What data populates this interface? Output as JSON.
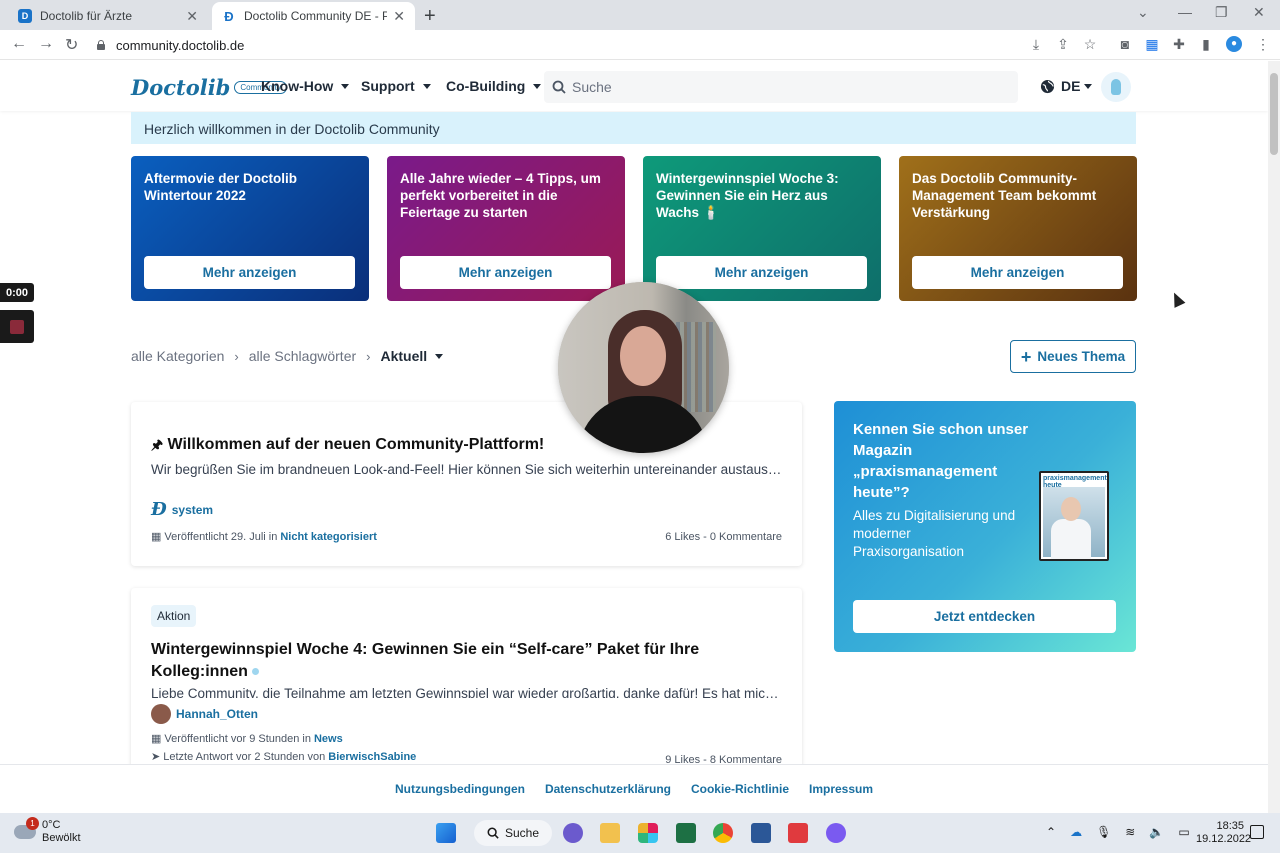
{
  "browser": {
    "tabs": [
      {
        "label": "Doctolib für Ärzte",
        "active": false
      },
      {
        "label": "Doctolib Community DE - Plattfo",
        "active": true
      }
    ],
    "url": "community.doctolib.de"
  },
  "header": {
    "logo_word": "Doctolib",
    "logo_pill": "Community",
    "nav": [
      {
        "label": "Know-How"
      },
      {
        "label": "Support"
      },
      {
        "label": "Co-Building"
      }
    ],
    "search_placeholder": "Suche",
    "language": "DE"
  },
  "welcome_banner": "Herzlich willkommen in der Doctolib Community",
  "featured_cards": [
    {
      "title": "Aftermovie der Doctolib Wintertour 2022",
      "button": "Mehr anzeigen",
      "color": "#0a4aa0"
    },
    {
      "title": "Alle Jahre wieder – 4 Tipps, um perfekt vorbereitet in die Feiertage zu starten",
      "button": "Mehr anzeigen",
      "color": "#8a1a70"
    },
    {
      "title": "Wintergewinnspiel Woche 3: Gewinnen Sie ein Herz aus Wachs 🕯️",
      "button": "Mehr anzeigen",
      "color": "#0e8a74"
    },
    {
      "title": "Das Doctolib Community-Management Team bekommt Verstärkung",
      "button": "Mehr anzeigen",
      "color": "#7a4e14"
    }
  ],
  "breadcrumbs": {
    "categories": "alle Kategorien",
    "tags": "alle Schlagwörter",
    "current": "Aktuell"
  },
  "new_topic_button": "Neues Thema",
  "posts": [
    {
      "pinned": true,
      "title": "Willkommen auf der neuen Community-Plattform!",
      "excerpt": "Wir begrüßen Sie im brandneuen Look-and-Feel! Hier können Sie sich weiterhin untereinander austauschen, …",
      "author": "system",
      "published": "Veröffentlicht 29. Juli in",
      "category": "Nicht kategorisiert",
      "stats": "6 Likes - 0 Kommentare"
    },
    {
      "tag": "Aktion",
      "title": "Wintergewinnspiel Woche 4: Gewinnen Sie ein “Self-care” Paket für Ihre Kolleg:innen",
      "excerpt": "Liebe Community, die Teilnahme am letzten Gewinnspiel war wieder großartig, danke dafür! Es hat mich sehr",
      "author": "Hannah_Otten",
      "published": "Veröffentlicht vor 9 Stunden in",
      "category": "News",
      "last_reply": "Letzte Antwort vor 2 Stunden von",
      "last_reply_user": "BierwischSabine",
      "stats": "9 Likes - 8 Kommentare"
    }
  ],
  "promo": {
    "heading": "Kennen Sie schon unser Magazin „praxismanagement heute”?",
    "sub": "Alles zu Digitalisierung und moderner Praxisorganisation",
    "button": "Jetzt entdecken",
    "magazine_title": "praxismanagement heute"
  },
  "footer": {
    "links": [
      "Nutzungsbedingungen",
      "Datenschutzerklärung",
      "Cookie-Richtlinie",
      "Impressum"
    ]
  },
  "recorder": {
    "time": "0:00"
  },
  "taskbar": {
    "weather_temp": "0°C",
    "weather_desc": "Bewölkt",
    "weather_badge": "1",
    "search_label": "Suche",
    "time": "18:35",
    "date": "19.12.2022"
  }
}
